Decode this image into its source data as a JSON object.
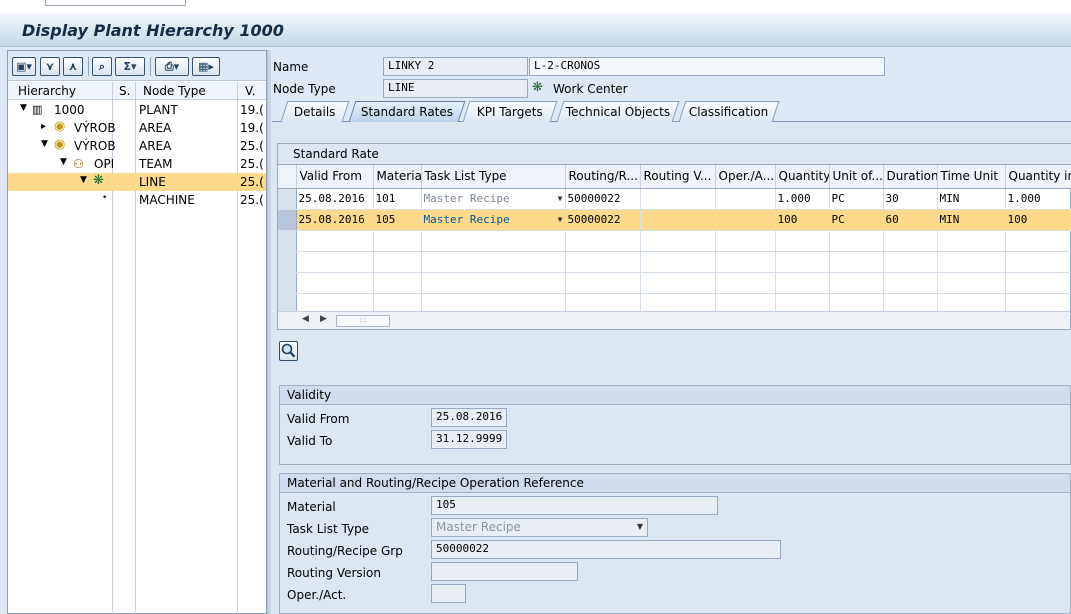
{
  "window": {
    "title": "Display Plant Hierarchy 1000"
  },
  "tree": {
    "columns": [
      "Hierarchy",
      "S.",
      "Node Type",
      "V."
    ],
    "rows": [
      {
        "name": "1000",
        "type": "PLANT",
        "v": "19.(",
        "expander": "▼",
        "icon": "plant-icon"
      },
      {
        "name": "VÝROB",
        "type": "AREA",
        "v": "19.(",
        "expander": "▸",
        "icon": "area-icon"
      },
      {
        "name": "VÝROB",
        "type": "AREA",
        "v": "25.(",
        "expander": "▼",
        "icon": "area-icon"
      },
      {
        "name": "OPI",
        "type": "TEAM",
        "v": "25.(",
        "expander": "▼",
        "icon": "team-icon"
      },
      {
        "name": "",
        "type": "LINE",
        "v": "25.(",
        "expander": "▼",
        "icon": "work-center-icon"
      },
      {
        "name": "",
        "type": "MACHINE",
        "v": "25.(",
        "expander": "•",
        "icon": ""
      }
    ]
  },
  "header": {
    "name_label": "Name",
    "name_value": "LINKY 2",
    "name_desc": "L-2-CRONOS",
    "node_type_label": "Node Type",
    "node_type_value": "LINE",
    "node_type_desc": "Work Center"
  },
  "tabs": [
    "Details",
    "Standard Rates",
    "KPI Targets",
    "Technical Objects",
    "Classification"
  ],
  "standard_rates": {
    "title": "Standard Rate",
    "columns": [
      "Valid From",
      "Material",
      "Task List Type",
      "Routing/R...",
      "Routing V...",
      "Oper./A...",
      "Quantity",
      "Unit of...",
      "Duration",
      "Time Unit",
      "Quantity in"
    ],
    "rows": [
      {
        "valid_from": "25.08.2016",
        "material": "101",
        "task_list_type": "Master Recipe",
        "routing": "50000022",
        "routing_v": "",
        "oper": "",
        "quantity": "1.000",
        "unit": "PC",
        "duration": "30",
        "time_unit": "MIN",
        "quantity_in": "1.000"
      },
      {
        "valid_from": "25.08.2016",
        "material": "105",
        "task_list_type": "Master Recipe",
        "routing": "50000022",
        "routing_v": "",
        "oper": "",
        "quantity": "100",
        "unit": "PC",
        "duration": "60",
        "time_unit": "MIN",
        "quantity_in": "100"
      }
    ]
  },
  "validity": {
    "title": "Validity",
    "valid_from_label": "Valid From",
    "valid_from": "25.08.2016",
    "valid_to_label": "Valid To",
    "valid_to": "31.12.9999"
  },
  "material_ref": {
    "title": "Material and Routing/Recipe Operation Reference",
    "material_label": "Material",
    "material": "105",
    "task_list_label": "Task List Type",
    "task_list": "Master Recipe",
    "routing_grp_label": "Routing/Recipe Grp",
    "routing_grp": "50000022",
    "routing_version_label": "Routing Version",
    "routing_version": "",
    "oper_label": "Oper./Act.",
    "oper": ""
  }
}
